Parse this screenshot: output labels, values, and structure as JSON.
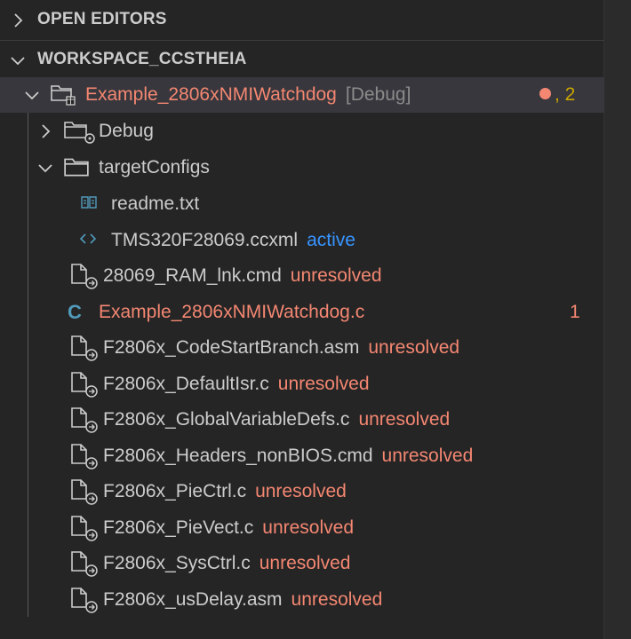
{
  "sections": {
    "open_editors": {
      "label": "OPEN EDITORS"
    },
    "workspace": {
      "label": "WORKSPACE_CCSTHEIA"
    }
  },
  "project": {
    "name": "Example_2806xNMIWatchdog",
    "config": "[Debug]",
    "problems_sep": ", ",
    "problems_count": "2"
  },
  "tree": {
    "debug": {
      "label": "Debug"
    },
    "target_configs": {
      "label": "targetConfigs"
    },
    "readme": {
      "label": "readme.txt"
    },
    "ccxml": {
      "label": "TMS320F28069.ccxml",
      "status": "active"
    },
    "files": [
      {
        "label": "28069_RAM_lnk.cmd",
        "status": "unresolved"
      },
      {
        "label": "Example_2806xNMIWatchdog.c",
        "count": "1"
      },
      {
        "label": "F2806x_CodeStartBranch.asm",
        "status": "unresolved"
      },
      {
        "label": "F2806x_DefaultIsr.c",
        "status": "unresolved"
      },
      {
        "label": "F2806x_GlobalVariableDefs.c",
        "status": "unresolved"
      },
      {
        "label": "F2806x_Headers_nonBIOS.cmd",
        "status": "unresolved"
      },
      {
        "label": "F2806x_PieCtrl.c",
        "status": "unresolved"
      },
      {
        "label": "F2806x_PieVect.c",
        "status": "unresolved"
      },
      {
        "label": "F2806x_SysCtrl.c",
        "status": "unresolved"
      },
      {
        "label": "F2806x_usDelay.asm",
        "status": "unresolved"
      }
    ]
  },
  "colors": {
    "background": "#252526",
    "selection": "#37373d",
    "error": "#f48771",
    "info": "#3794ff",
    "warning": "#cca700",
    "c_file": "#519aba"
  },
  "icons": {
    "collapsed": "chevron-right-icon",
    "expanded": "chevron-down-icon",
    "folder": "folder-icon",
    "file": "file-link-icon",
    "readme": "book-icon",
    "ccxml": "code-icon",
    "c_source": "c-language-icon"
  }
}
